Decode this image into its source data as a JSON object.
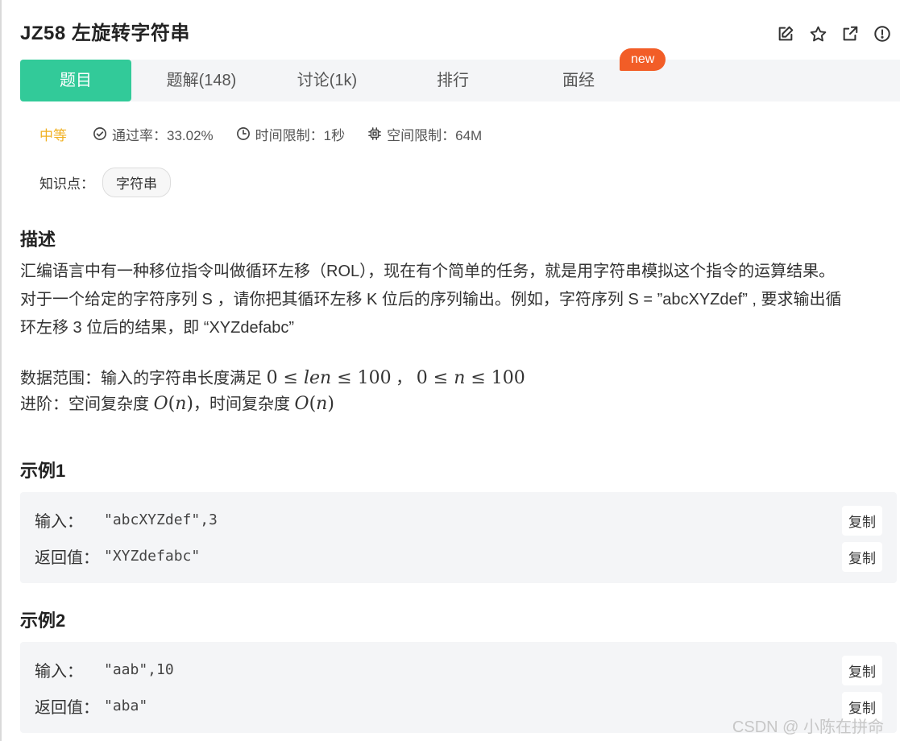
{
  "problem": {
    "title": "JZ58  左旋转字符串"
  },
  "header_icons": [
    "edit-icon",
    "star-icon",
    "external-link-icon",
    "report-icon"
  ],
  "tabs": [
    {
      "label": "题目",
      "active": true
    },
    {
      "label": "题解(148)",
      "active": false
    },
    {
      "label": "讨论(1k)",
      "active": false
    },
    {
      "label": "排行",
      "active": false
    },
    {
      "label": "面经",
      "active": false
    }
  ],
  "badge_new": "new",
  "meta": {
    "difficulty": "中等",
    "pass_rate": "通过率：33.02%",
    "time_limit": "时间限制：1秒",
    "space_limit": "空间限制：64M"
  },
  "knowledge": {
    "label": "知识点：",
    "tags": [
      "字符串"
    ]
  },
  "description": {
    "heading": "描述",
    "line1": "汇编语言中有一种移位指令叫做循环左移（ROL），现在有个简单的任务，就是用字符串模拟这个指令的运算结果。",
    "line2": "对于一个给定的字符序列  S ，请你把其循环左移 K 位后的序列输出。例如，字符序列 S = ”abcXYZdef” , 要求输出循",
    "line3": "环左移 3 位后的结果，即 “XYZdefabc”",
    "range_prefix": "数据范围：输入的字符串长度满足 ",
    "range_sep": " ， ",
    "advanced_prefix": "进阶：空间复杂度 ",
    "advanced_mid": "，时间复杂度 "
  },
  "examples": [
    {
      "heading": "示例1",
      "input_label": "输入：",
      "input_value": "\"abcXYZdef\",3",
      "output_label": "返回值：",
      "output_value": "\"XYZdefabc\"",
      "copy_label": "复制"
    },
    {
      "heading": "示例2",
      "input_label": "输入：",
      "input_value": "\"aab\",10",
      "output_label": "返回值：",
      "output_value": "\"aba\"",
      "copy_label": "复制"
    }
  ],
  "watermark": "CSDN @   小陈在拼命",
  "colors": {
    "accent": "#32ca99",
    "difficulty": "#f0b021",
    "badge": "#f25d27"
  }
}
